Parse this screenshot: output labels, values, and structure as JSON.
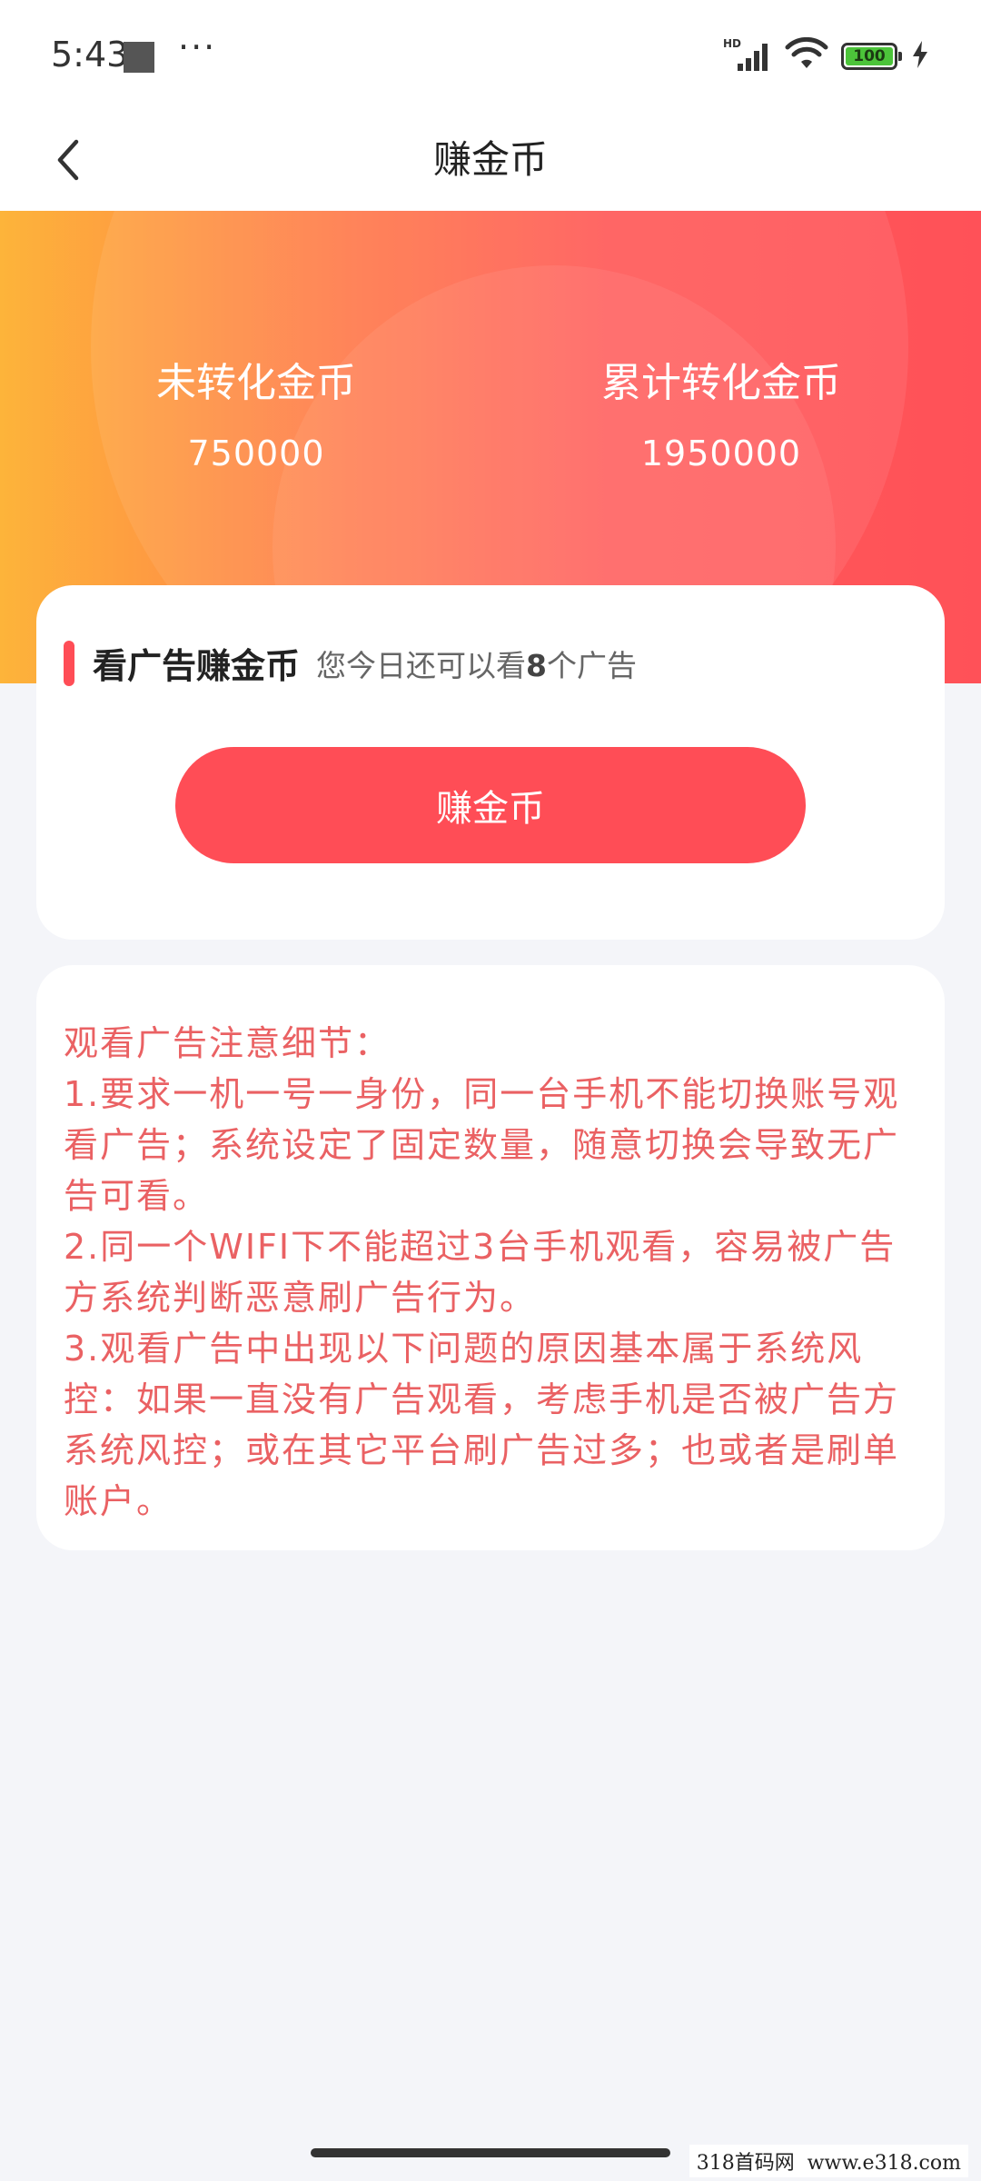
{
  "status_bar": {
    "time": "5:43",
    "dots": "···",
    "signal_badge": "HD",
    "battery_level": "100",
    "icons": [
      "square-notification-icon",
      "more-dots-icon",
      "signal-icon",
      "wifi-icon",
      "battery-icon",
      "charging-icon"
    ]
  },
  "nav": {
    "title": "赚金币",
    "back_icon": "chevron-left-icon"
  },
  "stats": {
    "unconverted_label": "未转化金币",
    "unconverted_value": "750000",
    "converted_label": "累计转化金币",
    "converted_value": "1950000"
  },
  "ad_card": {
    "title": "看广告赚金币",
    "subtitle_prefix": "您今日还可以看",
    "remaining_count": "8",
    "subtitle_suffix": "个广告",
    "button_label": "赚金币"
  },
  "notes": {
    "heading": "观看广告注意细节：",
    "items": [
      "1.要求一机一号一身份，同一台手机不能切换账号观看广告；系统设定了固定数量，随意切换会导致无广告可看。",
      "2.同一个WIFI下不能超过3台手机观看，容易被广告方系统判断恶意刷广告行为。",
      "3.观看广告中出现以下问题的原因基本属于系统风控：如果一直没有广告观看，考虑手机是否被广告方系统风控；或在其它平台刷广告过多；也或者是刷单账户。"
    ]
  },
  "watermark": "318首码网  www.e318.com",
  "colors": {
    "accent": "#ff4d56",
    "gradient_start": "#fdb43a",
    "gradient_end": "#ff5158",
    "notes_text": "#ea6163",
    "background": "#f4f5f9"
  }
}
